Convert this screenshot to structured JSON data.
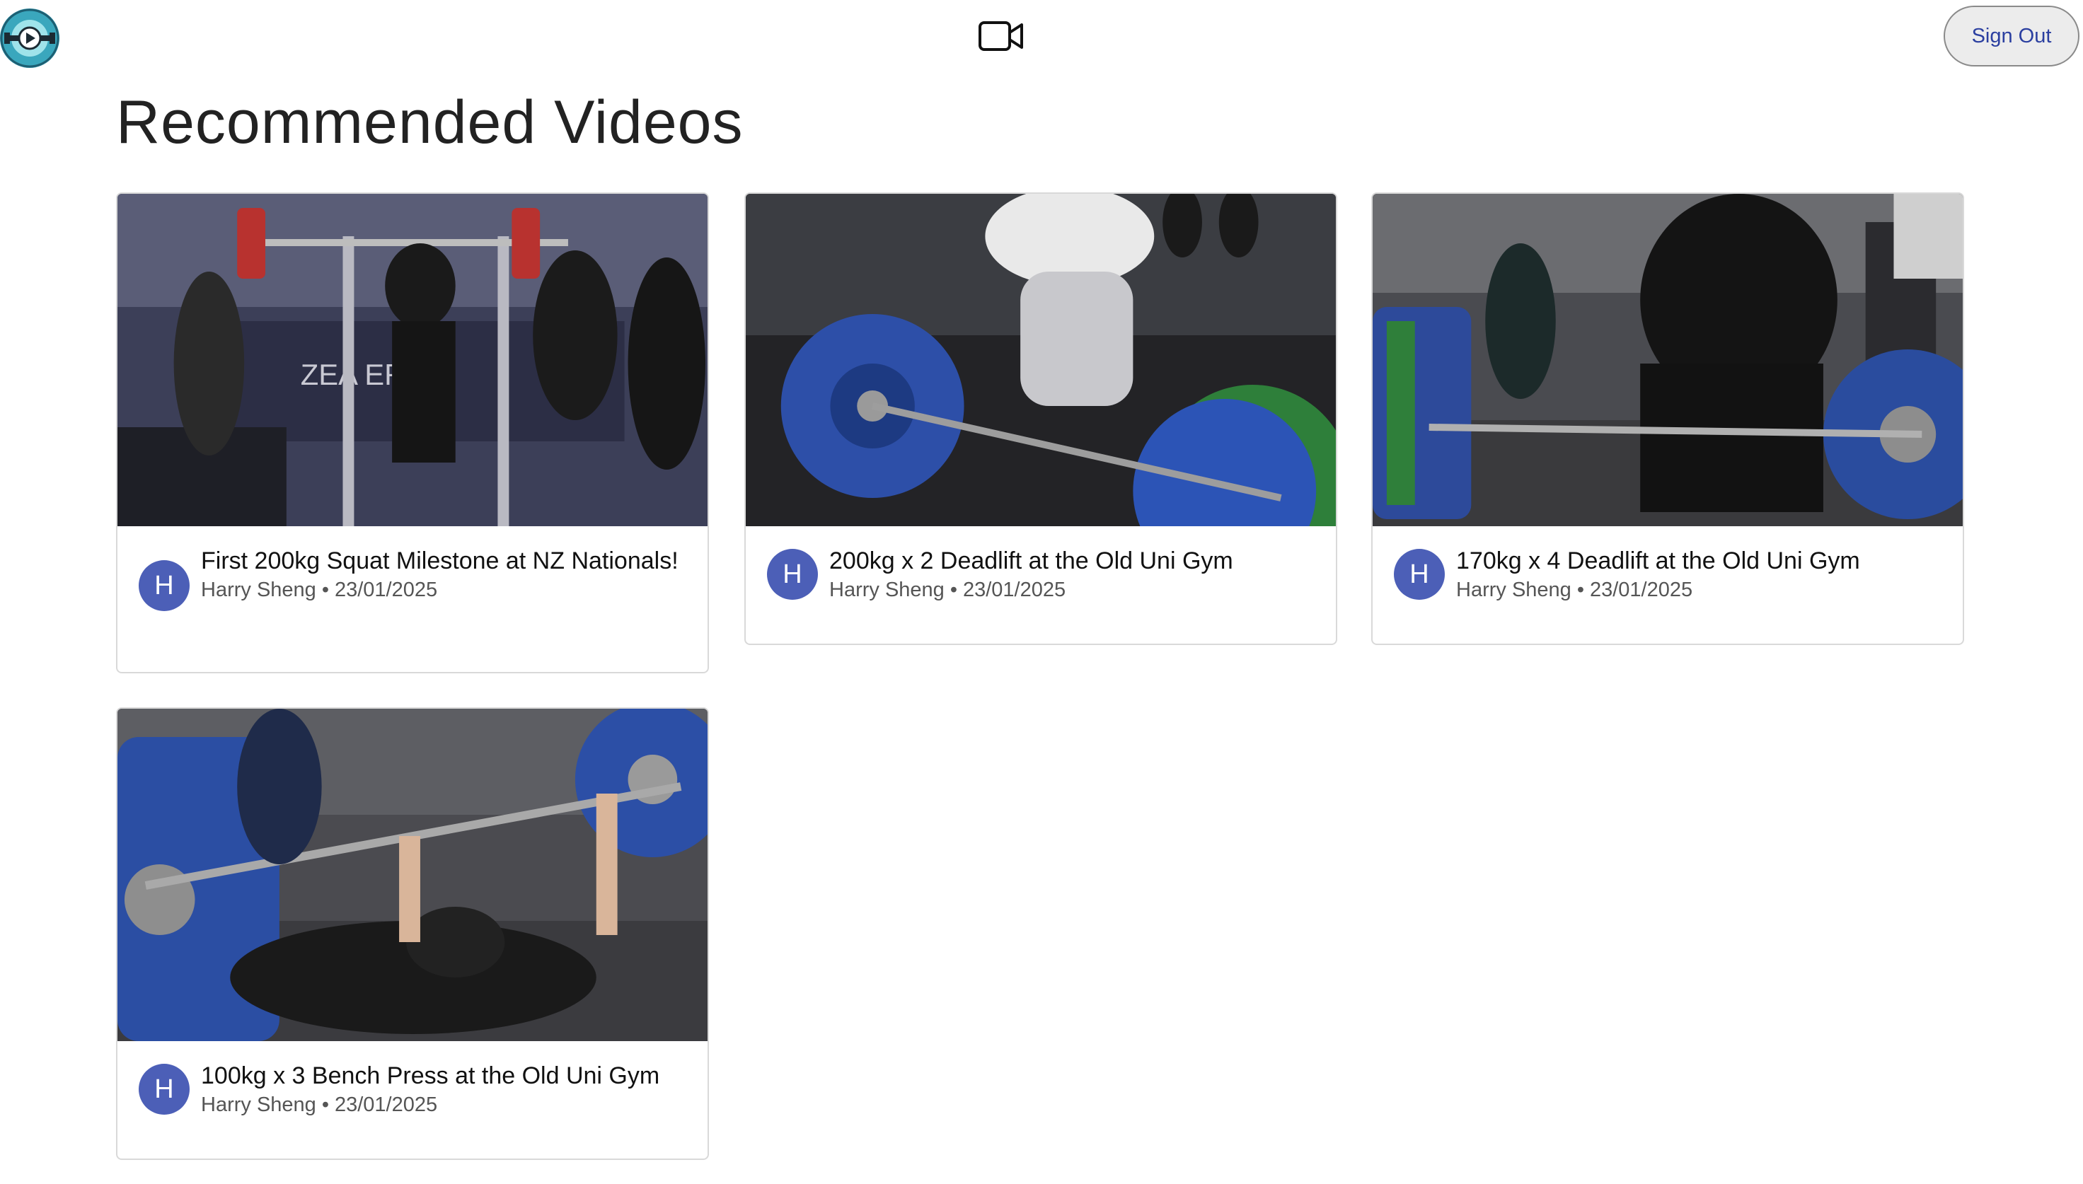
{
  "header": {
    "logo_icon": "app-logo-icon",
    "camera_icon": "video-camera-icon",
    "signout_label": "Sign Out"
  },
  "main": {
    "title": "Recommended Videos",
    "videos": [
      {
        "title": "First 200kg Squat Milestone at NZ Nationals!",
        "avatar_letter": "H",
        "author": "Harry Sheng",
        "date": "23/01/2025",
        "separator": "•"
      },
      {
        "title": "200kg x 2 Deadlift at the Old Uni Gym",
        "avatar_letter": "H",
        "author": "Harry Sheng",
        "date": "23/01/2025",
        "separator": "•"
      },
      {
        "title": "170kg x 4 Deadlift at the Old Uni Gym",
        "avatar_letter": "H",
        "author": "Harry Sheng",
        "date": "23/01/2025",
        "separator": "•"
      },
      {
        "title": "100kg x 3 Bench Press at the Old Uni Gym",
        "avatar_letter": "H",
        "author": "Harry Sheng",
        "date": "23/01/2025",
        "separator": "•"
      }
    ]
  },
  "colors": {
    "avatar": "#4c5fb7",
    "signout_text": "#2b3fa0"
  }
}
